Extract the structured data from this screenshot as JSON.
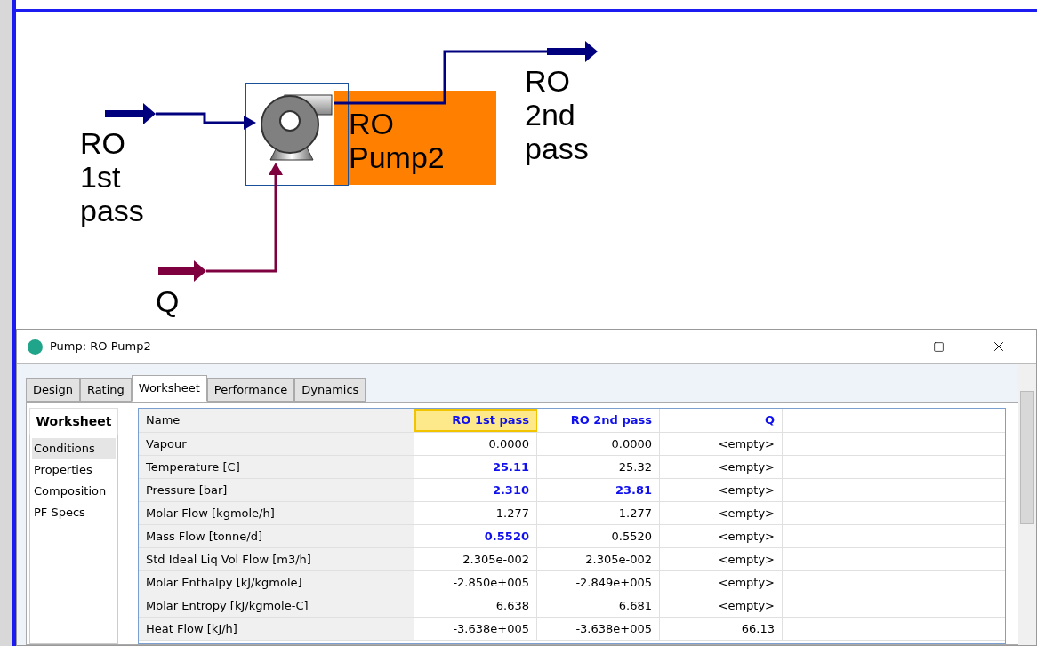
{
  "flowsheet": {
    "unit": {
      "label": "RO Pump2",
      "selected": true
    },
    "streams": [
      {
        "kind": "material",
        "label": "RO 1st pass"
      },
      {
        "kind": "material",
        "label": "RO 2nd pass"
      },
      {
        "kind": "energy",
        "label": "Q"
      }
    ]
  },
  "dialog": {
    "title": "Pump: RO Pump2",
    "tabs": [
      {
        "label": "Design",
        "selected": false
      },
      {
        "label": "Rating",
        "selected": false
      },
      {
        "label": "Worksheet",
        "selected": true
      },
      {
        "label": "Performance",
        "selected": false
      },
      {
        "label": "Dynamics",
        "selected": false
      }
    ],
    "nav": {
      "heading": "Worksheet",
      "items": [
        {
          "label": "Conditions",
          "selected": true
        },
        {
          "label": "Properties",
          "selected": false
        },
        {
          "label": "Composition",
          "selected": false
        },
        {
          "label": "PF Specs",
          "selected": false
        }
      ]
    },
    "table": {
      "columns": [
        {
          "label": "Name",
          "selected": false
        },
        {
          "label": "RO 1st pass",
          "selected": true
        },
        {
          "label": "RO 2nd pass",
          "selected": false
        },
        {
          "label": "Q",
          "selected": false
        }
      ],
      "rows": [
        {
          "cells": [
            {
              "text": "Vapour"
            },
            {
              "text": "0.0000",
              "specified": false
            },
            {
              "text": "0.0000",
              "specified": false
            },
            {
              "text": "<empty>",
              "specified": false
            }
          ]
        },
        {
          "cells": [
            {
              "text": "Temperature [C]"
            },
            {
              "text": "25.11",
              "specified": true
            },
            {
              "text": "25.32",
              "specified": false
            },
            {
              "text": "<empty>",
              "specified": false
            }
          ]
        },
        {
          "cells": [
            {
              "text": "Pressure [bar]"
            },
            {
              "text": "2.310",
              "specified": true
            },
            {
              "text": "23.81",
              "specified": true
            },
            {
              "text": "<empty>",
              "specified": false
            }
          ]
        },
        {
          "cells": [
            {
              "text": "Molar Flow [kgmole/h]"
            },
            {
              "text": "1.277",
              "specified": false
            },
            {
              "text": "1.277",
              "specified": false
            },
            {
              "text": "<empty>",
              "specified": false
            }
          ]
        },
        {
          "cells": [
            {
              "text": "Mass Flow [tonne/d]"
            },
            {
              "text": "0.5520",
              "specified": true
            },
            {
              "text": "0.5520",
              "specified": false
            },
            {
              "text": "<empty>",
              "specified": false
            }
          ]
        },
        {
          "cells": [
            {
              "text": "Std Ideal Liq Vol Flow [m3/h]"
            },
            {
              "text": "2.305e-002",
              "specified": false
            },
            {
              "text": "2.305e-002",
              "specified": false
            },
            {
              "text": "<empty>",
              "specified": false
            }
          ]
        },
        {
          "cells": [
            {
              "text": "Molar Enthalpy [kJ/kgmole]"
            },
            {
              "text": "-2.850e+005",
              "specified": false
            },
            {
              "text": "-2.849e+005",
              "specified": false
            },
            {
              "text": "<empty>",
              "specified": false
            }
          ]
        },
        {
          "cells": [
            {
              "text": "Molar Entropy [kJ/kgmole-C]"
            },
            {
              "text": "6.638",
              "specified": false
            },
            {
              "text": "6.681",
              "specified": false
            },
            {
              "text": "<empty>",
              "specified": false
            }
          ]
        },
        {
          "cells": [
            {
              "text": "Heat Flow [kJ/h]"
            },
            {
              "text": "-3.638e+005",
              "specified": false
            },
            {
              "text": "-3.638e+005",
              "specified": false
            },
            {
              "text": "66.13",
              "specified": false
            }
          ]
        }
      ]
    }
  }
}
